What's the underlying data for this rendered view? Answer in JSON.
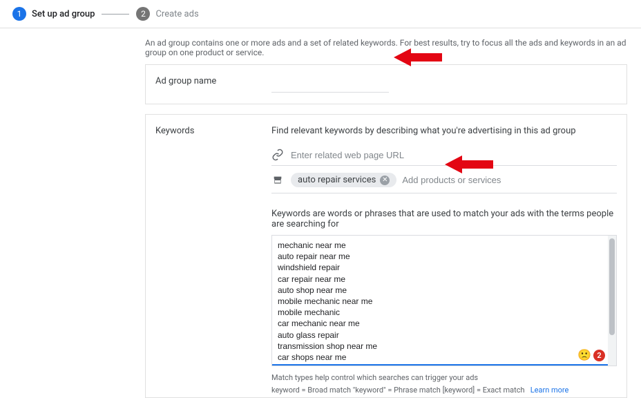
{
  "stepper": {
    "step1": {
      "num": "1",
      "label": "Set up ad group"
    },
    "step2": {
      "num": "2",
      "label": "Create ads"
    }
  },
  "intro": "An ad group contains one or more ads and a set of related keywords. For best results, try to focus all the ads and keywords in an ad group on one product or service.",
  "ad_group_name": {
    "label": "Ad group name",
    "value": ""
  },
  "keywords": {
    "label": "Keywords",
    "instr": "Find relevant keywords by describing what you're advertising in this ad group",
    "url_placeholder": "Enter related web page URL",
    "chip": "auto repair services",
    "add_products_placeholder": "Add products or services",
    "description": "Keywords are words or phrases that are used to match your ads with the terms people are searching for",
    "list": "mechanic near me\nauto repair near me\nwindshield repair\ncar repair near me\nauto shop near me\nmobile mechanic near me\nmobile mechanic\ncar mechanic near me\nauto glass repair\ntransmission shop near me\ncar shops near me\nwindshield replacement near me\nauto glass repair near me\nwindshield repair near me",
    "notification_count": "2",
    "match_help": "Match types help control which searches can trigger your ads",
    "match_examples": "keyword = Broad match   \"keyword\" = Phrase match   [keyword] = Exact match",
    "learn_more": "Learn more"
  }
}
